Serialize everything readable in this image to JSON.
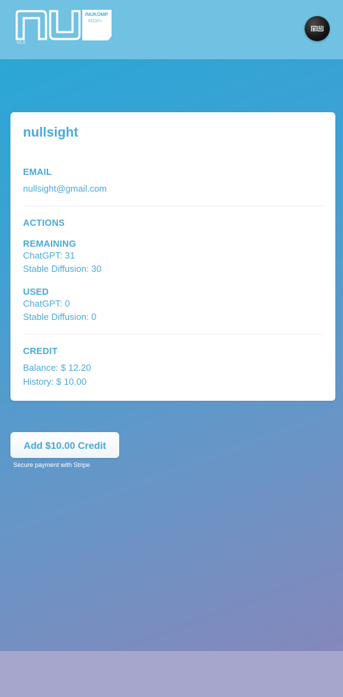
{
  "header": {
    "logo_mark": "NU",
    "logo_tag_line1": "/NUKOMP",
    "logo_tag_line2": "AIGen",
    "logo_version": "V1.0",
    "avatar_mark": "NU",
    "avatar_icon": "profile-avatar"
  },
  "account": {
    "username": "nullsight",
    "email_heading": "EMAIL",
    "email": "nullsight@gmail.com",
    "actions_heading": "ACTIONS",
    "remaining_heading": "REMAINING",
    "remaining_chatgpt": "ChatGPT: 31",
    "remaining_sd": "Stable Diffusion: 30",
    "used_heading": "USED",
    "used_chatgpt": "ChatGPT: 0",
    "used_sd": "Stable Diffusion: 0",
    "credit_heading": "CREDIT",
    "balance": "Balance: $ 12.20",
    "history": "History: $ 10.00"
  },
  "payment": {
    "add_credit_label": "Add $10.00 Credit",
    "stripe_note": "Secure payment with Stripe"
  },
  "colors": {
    "accent": "#4aaad8",
    "topbar": "#70c1e2",
    "bottombar": "#a6a6cc",
    "gradient_top": "#25a9d6",
    "gradient_bottom": "#8a85b9"
  }
}
